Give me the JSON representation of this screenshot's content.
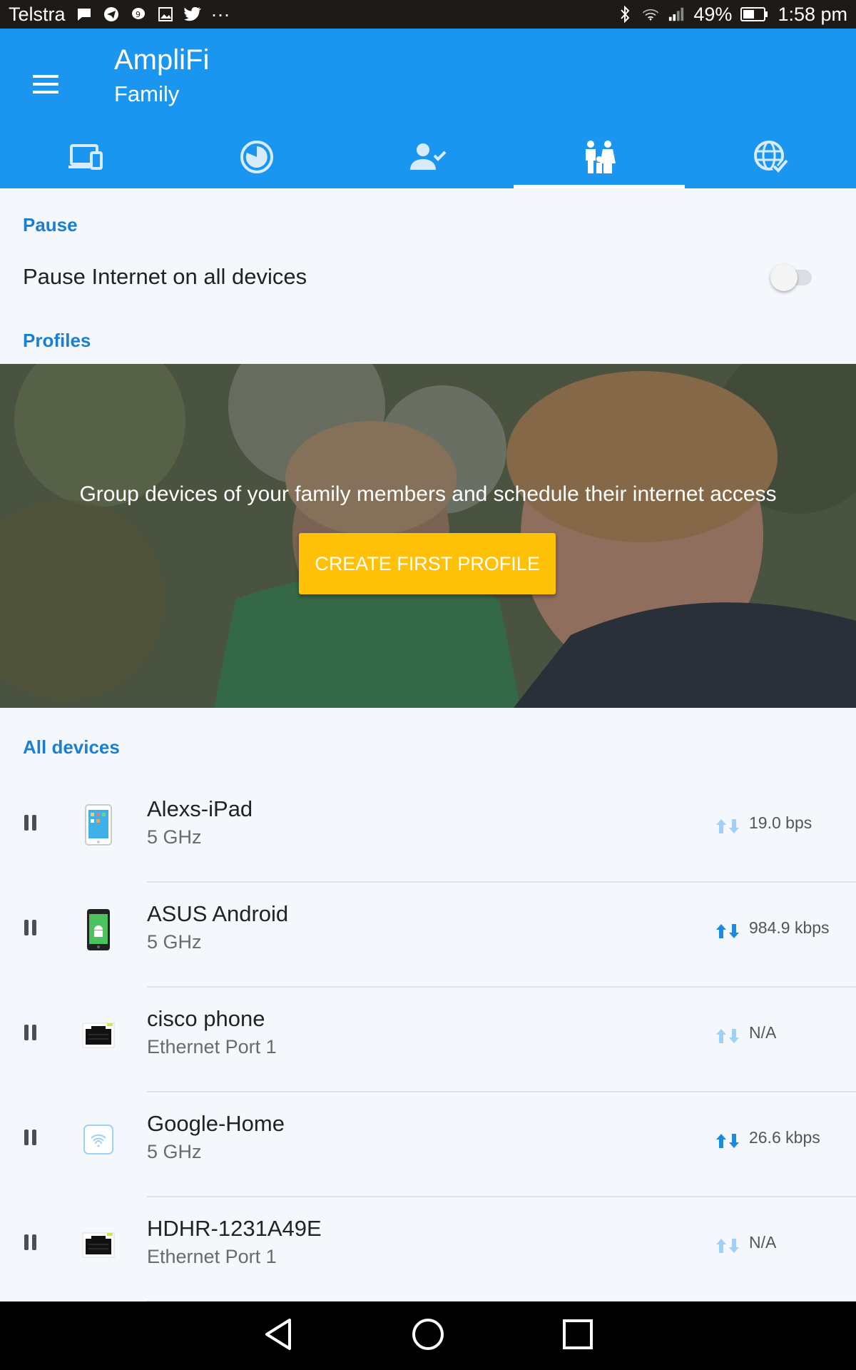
{
  "status_bar": {
    "carrier": "Telstra",
    "left_icons": [
      "message-icon",
      "telegram-icon",
      "chat-icon",
      "image-icon",
      "twitter-icon",
      "more-icon"
    ],
    "more": "···",
    "right_icons": [
      "bluetooth-icon",
      "wifi-icon",
      "signal-icon",
      "battery-icon"
    ],
    "battery": "49%",
    "time": "1:58 pm"
  },
  "app_bar": {
    "title": "AmpliFi",
    "subtitle": "Family",
    "menu_icon": "menu-icon",
    "background": "#1a96f0"
  },
  "tabs": [
    {
      "icon": "devices-icon",
      "active": false
    },
    {
      "icon": "usage-chart-icon",
      "active": false
    },
    {
      "icon": "user-check-icon",
      "active": false
    },
    {
      "icon": "family-icon",
      "active": true
    },
    {
      "icon": "globe-check-icon",
      "active": false
    }
  ],
  "pause_section": {
    "header": "Pause",
    "row_label": "Pause Internet on all devices",
    "toggle_on": false
  },
  "profiles_section": {
    "header": "Profiles",
    "hero_text": "Group devices of your family members and schedule their internet access",
    "cta_label": "CREATE FIRST PROFILE",
    "cta_color": "#ffc107"
  },
  "all_devices": {
    "header": "All devices",
    "devices": [
      {
        "name": "Alexs-iPad",
        "connection": "5 GHz",
        "rate": "19.0 bps",
        "icon": "tablet-icon",
        "active_traffic": false
      },
      {
        "name": "ASUS Android",
        "connection": "5 GHz",
        "rate": "984.9 kbps",
        "icon": "android-phone-icon",
        "active_traffic": true
      },
      {
        "name": "cisco phone",
        "connection": "Ethernet Port 1",
        "rate": "N/A",
        "icon": "ethernet-port-icon",
        "active_traffic": false
      },
      {
        "name": "Google-Home",
        "connection": "5 GHz",
        "rate": "26.6 kbps",
        "icon": "wifi-device-icon",
        "active_traffic": true
      },
      {
        "name": "HDHR-1231A49E",
        "connection": "Ethernet Port 1",
        "rate": "N/A",
        "icon": "ethernet-port-icon",
        "active_traffic": false
      }
    ]
  },
  "nav_bar": {
    "buttons": [
      "back-icon",
      "home-icon",
      "recents-icon"
    ]
  }
}
